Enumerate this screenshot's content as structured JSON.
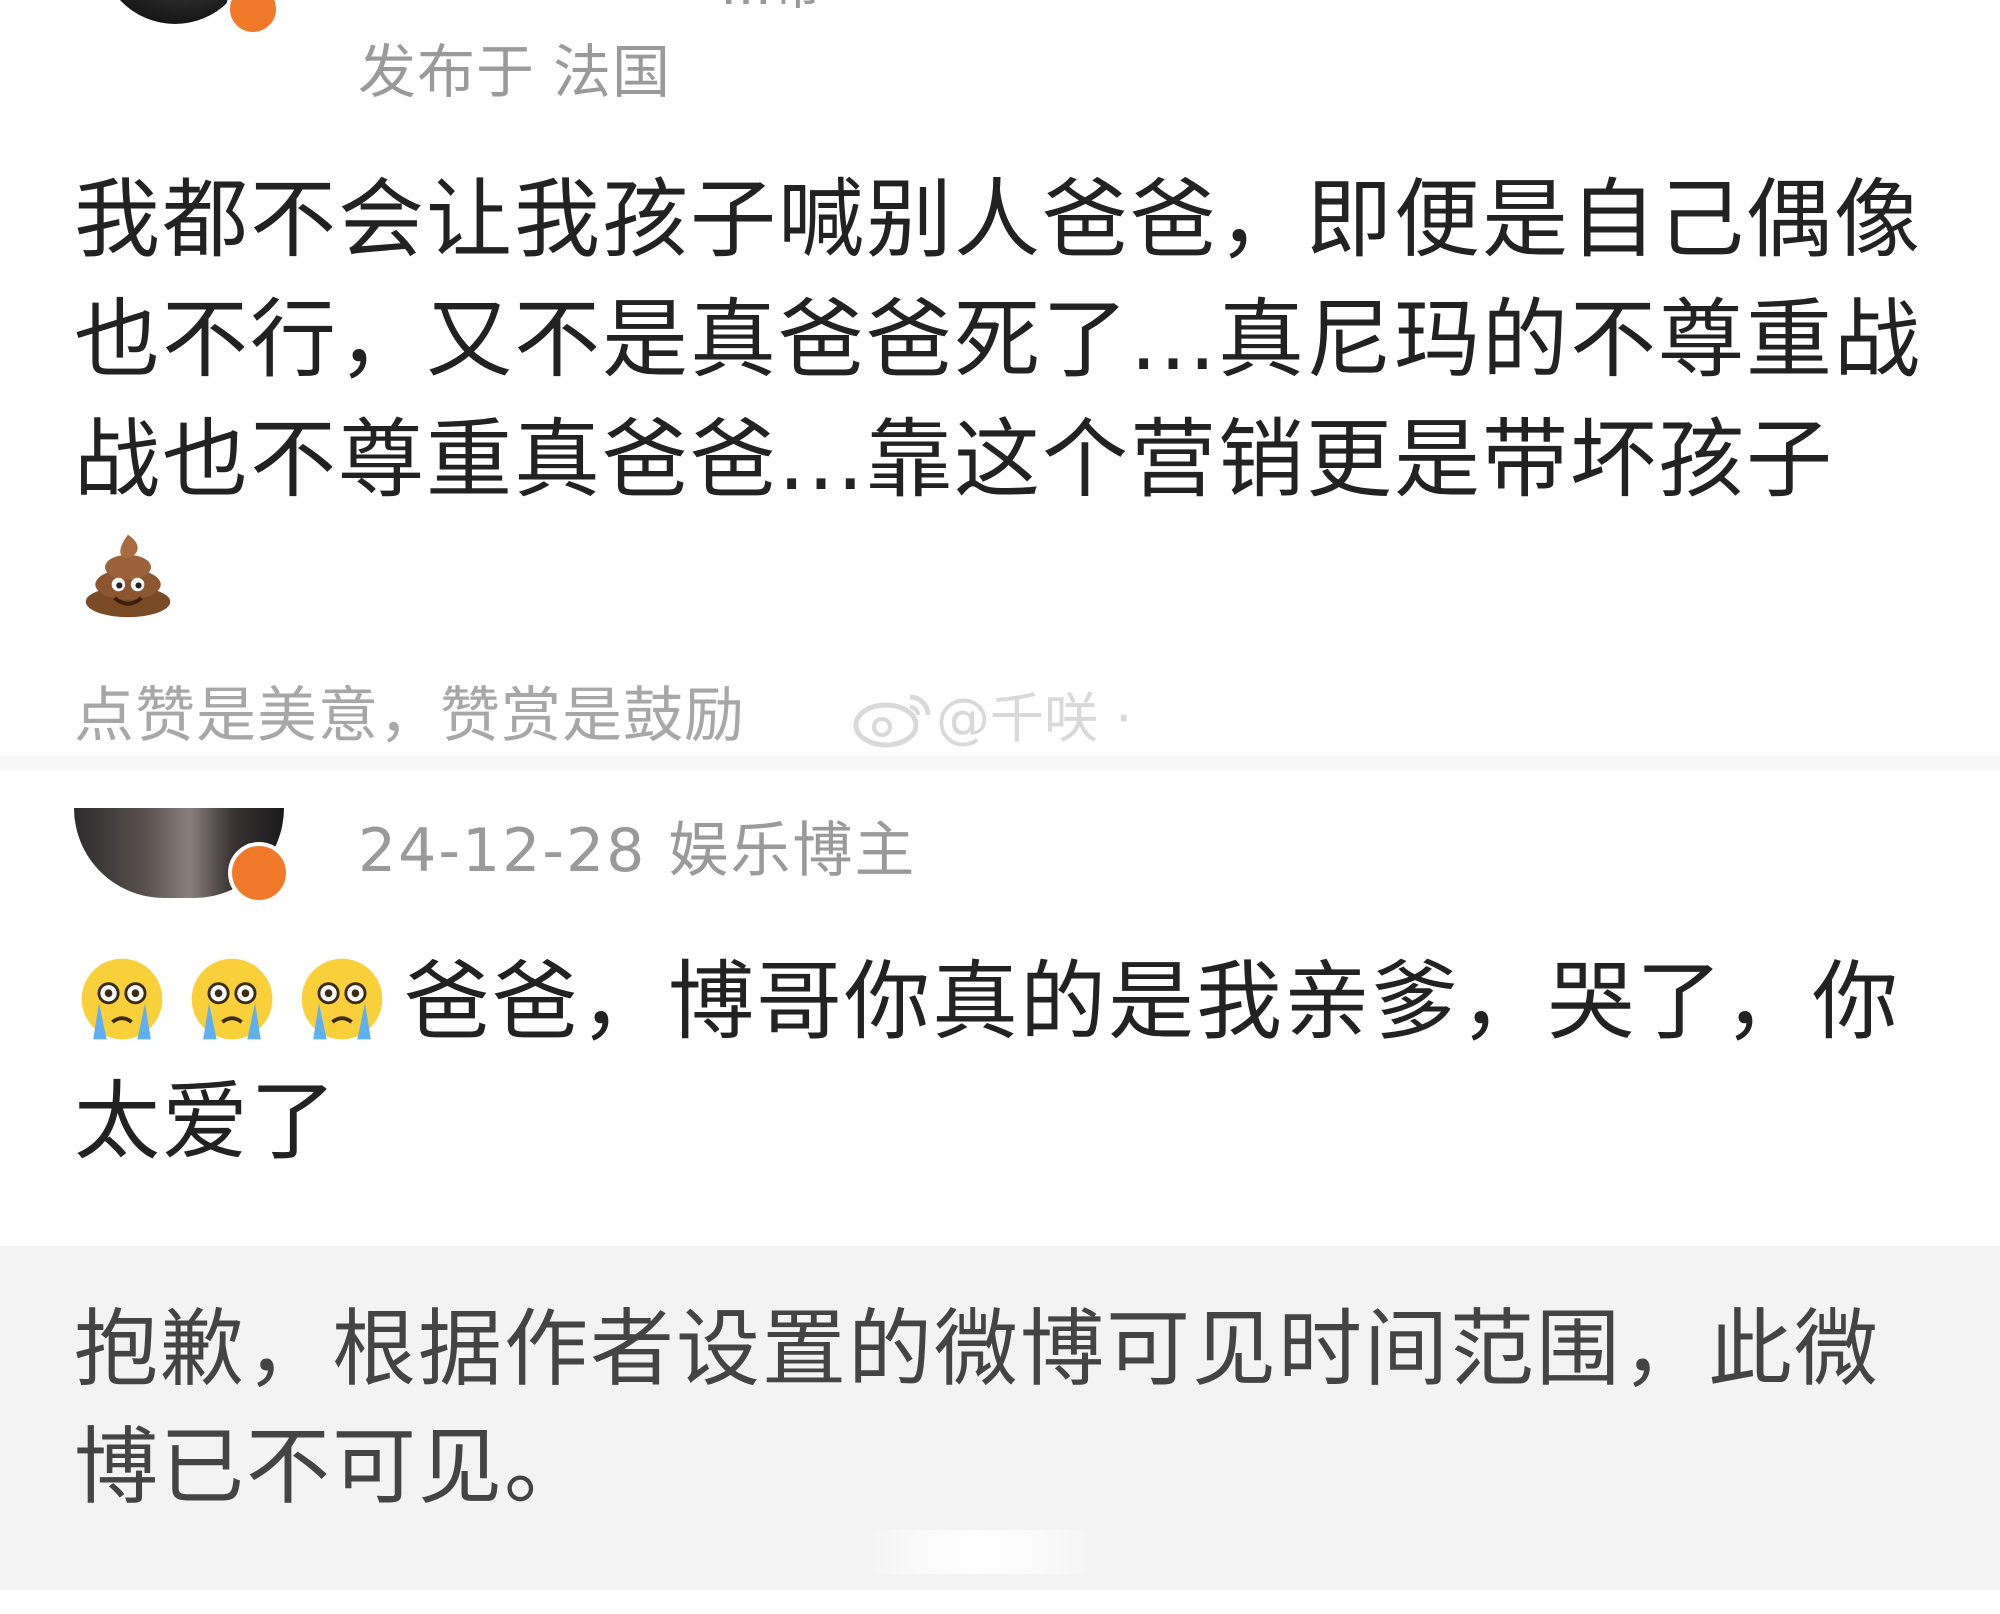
{
  "post1": {
    "name_fragment": "…帝",
    "meta": {
      "published_label": "发布于",
      "location": "法国"
    },
    "text": "我都不会让我孩子喊别人爸爸，即便是自己偶像也不行，又不是真爸爸死了...真尼玛的不尊重战战也不尊重真爸爸...靠这个营销更是带坏孩子",
    "emoji": "poop-icon",
    "reward_text": "点赞是美意，赞赏是鼓励",
    "watermark": "@千咲"
  },
  "post2": {
    "meta": {
      "date": "24-12-28",
      "role": "娱乐博主"
    },
    "emojis": [
      "crying-face-icon",
      "crying-face-icon",
      "crying-face-icon"
    ],
    "text": "爸爸，博哥你真的是我亲爹，哭了，你太爱了"
  },
  "notice": {
    "text": "抱歉，根据作者设置的微博可见时间范围，此微博已不可见。"
  },
  "colors": {
    "verified_badge": "#f07a29",
    "meta_text": "#9a9a9a",
    "body_text": "#222222",
    "notice_bg": "#f3f3f3"
  }
}
